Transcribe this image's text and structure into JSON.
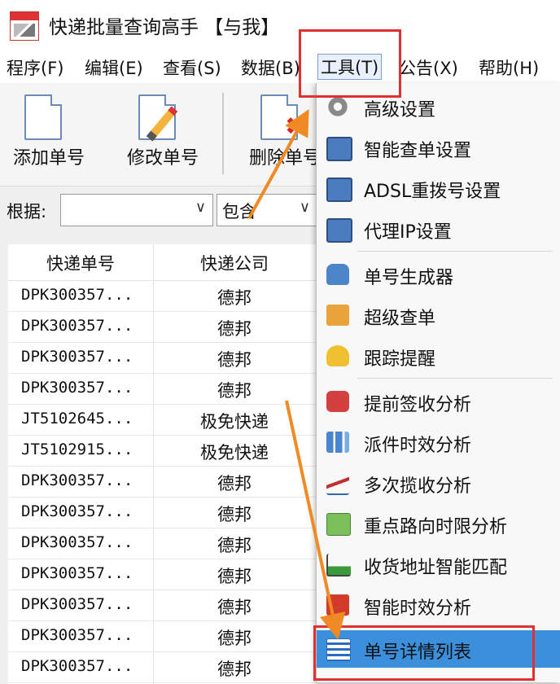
{
  "app": {
    "title": "快递批量查询高手 【与我】"
  },
  "menubar": [
    "程序(F)",
    "编辑(E)",
    "查看(S)",
    "数据(B)",
    "工具(T)",
    "公告(X)",
    "帮助(H)"
  ],
  "toolbar": {
    "add": "添加单号",
    "edit": "修改单号",
    "delete": "删除单号"
  },
  "filter": {
    "label": "根据:",
    "mode": "包含"
  },
  "table": {
    "headers": [
      "快递单号",
      "快递公司"
    ],
    "rows": [
      {
        "num": "DPK300357...",
        "company": "德邦"
      },
      {
        "num": "DPK300357...",
        "company": "德邦"
      },
      {
        "num": "DPK300357...",
        "company": "德邦"
      },
      {
        "num": "DPK300357...",
        "company": "德邦"
      },
      {
        "num": "JT5102645...",
        "company": "极免快递"
      },
      {
        "num": "JT5102915...",
        "company": "极免快递"
      },
      {
        "num": "DPK300357...",
        "company": "德邦"
      },
      {
        "num": "DPK300357...",
        "company": "德邦"
      },
      {
        "num": "DPK300357...",
        "company": "德邦"
      },
      {
        "num": "DPK300357...",
        "company": "德邦"
      },
      {
        "num": "DPK300357...",
        "company": "德邦"
      },
      {
        "num": "DPK300357...",
        "company": "德邦"
      },
      {
        "num": "DPK300357...",
        "company": "德邦"
      }
    ]
  },
  "tools_menu": [
    "高级设置",
    "智能查单设置",
    "ADSL重拨号设置",
    "代理IP设置",
    "单号生成器",
    "超级查单",
    "跟踪提醒",
    "提前签收分析",
    "派件时效分析",
    "多次揽收分析",
    "重点路向时限分析",
    "收货地址智能匹配",
    "智能时效分析",
    "单号详情列表"
  ],
  "colors": {
    "highlight": "#3c8fdb",
    "annotation_box": "#e03030",
    "annotation_arrow": "#f08a24"
  }
}
